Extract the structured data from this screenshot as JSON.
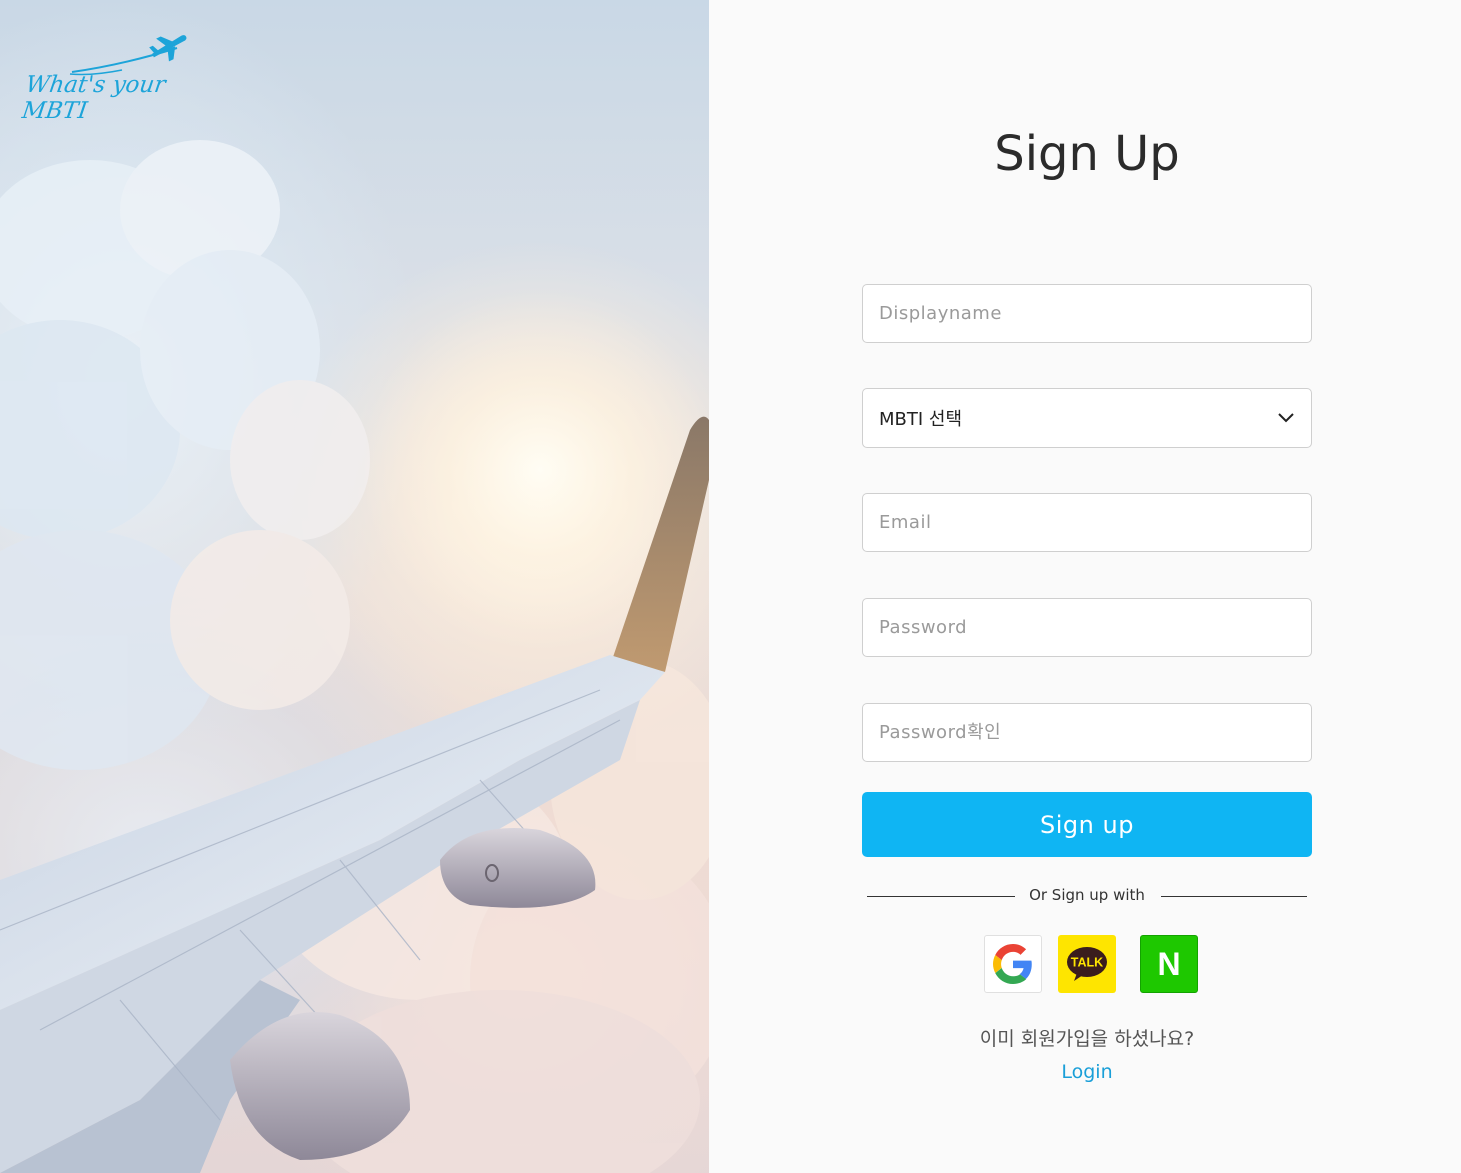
{
  "brand": {
    "logo_text": "What's your MBTI",
    "logo_color": "#1da4d9"
  },
  "form": {
    "title": "Sign Up",
    "displayname_placeholder": "Displayname",
    "mbti_select_value": "MBTI 선택",
    "email_placeholder": "Email",
    "password_placeholder": "Password",
    "password_confirm_placeholder": "Password확인",
    "submit_label": "Sign up",
    "divider_text": "Or Sign up with",
    "kakao_badge_text": "TALK",
    "naver_letter": "N",
    "already_member_text": "이미 회원가입을 하셨나요?",
    "login_link": "Login"
  },
  "colors": {
    "primary": "#0fb5f3",
    "link": "#1a9fd8",
    "kakao": "#fee500",
    "naver": "#1ec800"
  }
}
